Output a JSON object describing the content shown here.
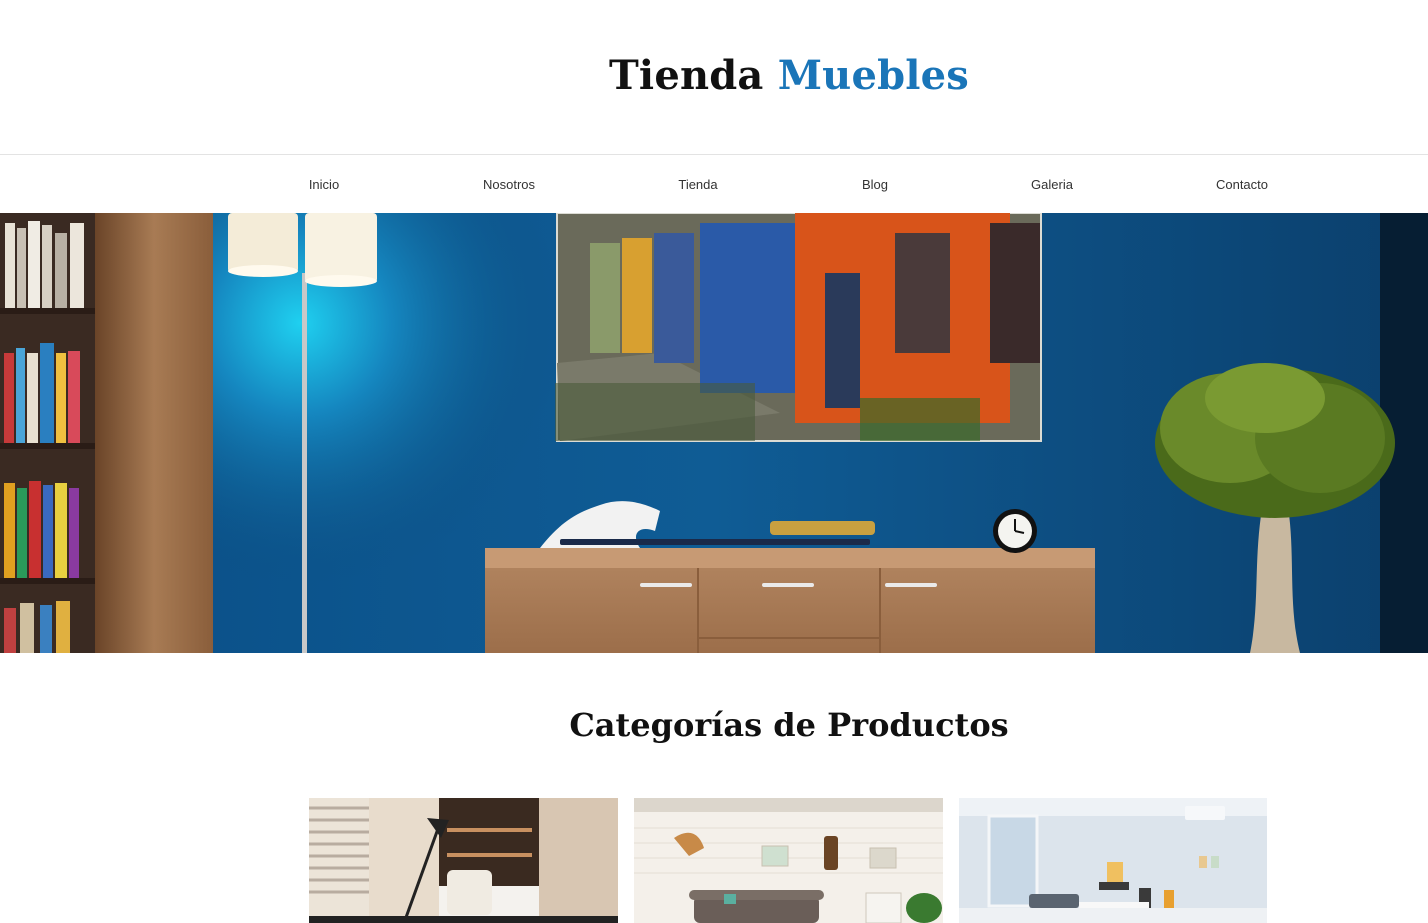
{
  "header": {
    "logo_part1": "Tienda",
    "logo_part2": "Muebles"
  },
  "nav": {
    "items": [
      {
        "label": "Inicio"
      },
      {
        "label": "Nosotros"
      },
      {
        "label": "Tienda"
      },
      {
        "label": "Blog"
      },
      {
        "label": "Galeria"
      },
      {
        "label": "Contacto"
      }
    ]
  },
  "categories": {
    "title": "Categorías de Productos"
  },
  "colors": {
    "brand_accent": "#1a75b8",
    "text": "#111111",
    "nav_text": "#333333",
    "wall_blue": "#0f5a8c"
  }
}
